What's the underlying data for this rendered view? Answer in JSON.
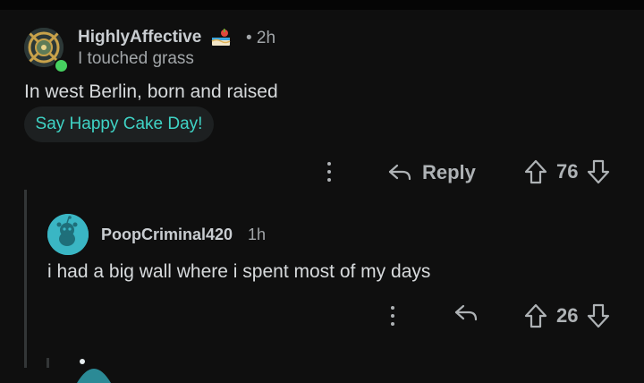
{
  "comment": {
    "username": "HighlyAffective",
    "time": "• 2h",
    "flair": "I touched grass",
    "body": "In west Berlin, born and raised",
    "cake_day_prompt": "Say Happy Cake Day!",
    "reply_label": "Reply",
    "score": "76",
    "avatar_icon": "medallion-avatar-icon",
    "online_color": "#46d160",
    "accent_color": "#3fd3c5"
  },
  "reply": {
    "username": "PoopCriminal420",
    "time": "1h",
    "body": "i had a big wall where i spent most of my days",
    "score": "26",
    "avatar_icon": "snoo-avatar-icon",
    "avatar_color": "#3ab6c4"
  }
}
